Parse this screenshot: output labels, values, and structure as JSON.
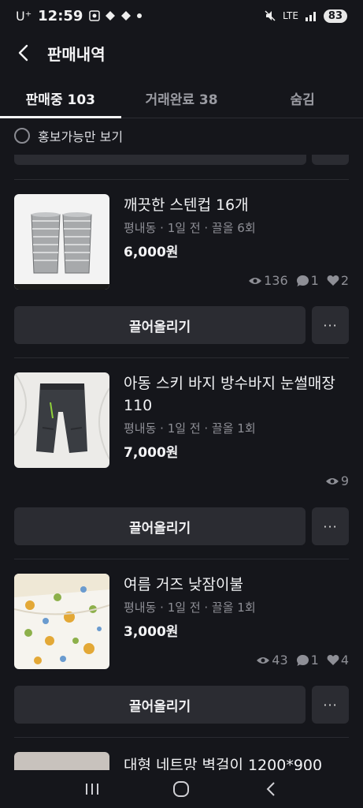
{
  "status_bar": {
    "carrier": "U⁺",
    "time": "12:59",
    "network": "LTE",
    "battery": "83",
    "icons": [
      "screenshot-icon",
      "notification-icon",
      "notification-icon",
      "dot-icon",
      "mute-icon",
      "signal-icon"
    ]
  },
  "header": {
    "title": "판매내역",
    "back_icon": "chevron-left-icon"
  },
  "tabs": [
    {
      "label": "판매중 103",
      "active": true
    },
    {
      "label": "거래완료 38",
      "active": false
    },
    {
      "label": "숨김",
      "active": false
    }
  ],
  "filter": {
    "label": "홍보가능만 보기",
    "checked": false
  },
  "items": [
    {
      "title": "깨끗한 스텐컵 16개",
      "meta": "평내동 · 1일 전 · 끌올 6회",
      "price": "6,000원",
      "stats": {
        "views": "136",
        "chats": "1",
        "likes": "2"
      },
      "bump_label": "끌어올리기",
      "more_label": "···"
    },
    {
      "title": "아동 스키 바지 방수바지 눈썰매장 110",
      "meta": "평내동 · 1일 전 · 끌올 1회",
      "price": "7,000원",
      "stats": {
        "views": "9"
      },
      "bump_label": "끌어올리기",
      "more_label": "···"
    },
    {
      "title": "여름 거즈 낮잠이불",
      "meta": "평내동 · 1일 전 · 끌올 1회",
      "price": "3,000원",
      "stats": {
        "views": "43",
        "chats": "1",
        "likes": "4"
      },
      "bump_label": "끌어올리기",
      "more_label": "···"
    }
  ],
  "next_item": {
    "title": "대형 네트망 벽걸이 1200*900"
  },
  "nav": {
    "icons": [
      "recent-apps-icon",
      "home-icon",
      "back-icon"
    ]
  },
  "colors": {
    "background": "#15161b",
    "button": "#2b2c32",
    "muted": "#8e8f96"
  }
}
